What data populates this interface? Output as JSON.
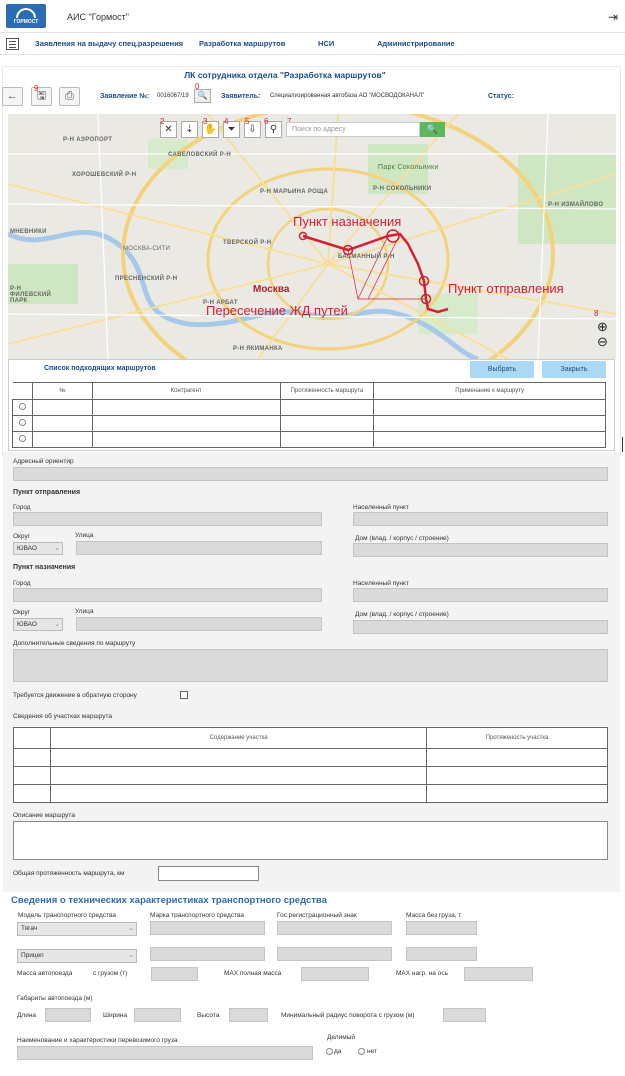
{
  "app": {
    "title": "АИС \"Гормост\"",
    "logo_text": "ГОРМОСТ"
  },
  "nav": {
    "items": [
      "Заявления на выдачу спец.разрешения",
      "Разработка маршрутов",
      "НСИ",
      "Администрирование"
    ]
  },
  "page": {
    "title": "ЛК сотрудника отдела \"Разработка маршрутов\""
  },
  "toolbar": {
    "application_label": "Заявление №:",
    "application_value": "0016067/19",
    "applicant_label": "Заявитель:",
    "applicant_value": "Специализированная автобаза АО \"МОСВОДОКАНАЛ\"",
    "status_label": "Статус:",
    "markers": [
      "0",
      "9"
    ]
  },
  "map": {
    "search_placeholder": "Поиск по адресу",
    "tool_markers": [
      "2",
      "3",
      "4",
      "5",
      "6",
      "7",
      "8"
    ],
    "annotations": {
      "destination": "Пункт назначения",
      "departure": "Пункт отправления",
      "crossing": "Пересечение ЖД путей",
      "city": "Москва"
    },
    "districts": [
      "Р-Н АЭРОПОРТ",
      "САВЕЛОВСКИЙ Р-Н",
      "ХОРОШЕВСКИЙ Р-Н",
      "Р-Н МАРЬИНА РОЩА",
      "МНЕВНИКИ",
      "ТВЕРСКОЙ Р-Н",
      "БАСМАННЫЙ Р-Н",
      "ПРЕСНЕНСКИЙ Р-Н",
      "Р-Н ФИЛЕВСКИЙ ПАРК",
      "Р-Н АРБАТ",
      "Р-Н ЯКИМАНКА",
      "Парк Сокольники",
      "Р-Н СОКОЛЬНИКИ",
      "Р-Н ИЗМАЙЛОВО",
      "МОСКВА-СИТИ"
    ]
  },
  "routes": {
    "title": "Список подходящих маршрутов",
    "select_button": "Выбрать",
    "close_button": "Закрыть",
    "columns": [
      "№",
      "Контрагент",
      "Протяженность маршрута",
      "Применание к маршруту"
    ]
  },
  "form": {
    "address_label": "Адресный ориентир",
    "departure_heading": "Пункт отправления",
    "destination_heading": "Пункт назначения",
    "city_label": "Город",
    "settlement_label": "Населенный пункт",
    "okrug_label": "Округ",
    "street_label": "Улица",
    "house_label": "Дом (влад. / корпус / строение)",
    "okrug_value": "ЮВАО",
    "extra_label": "Дополнительные сведения по маршруту",
    "reverse_label": "Требуется движение в обратную сторону",
    "sections_label": "Сведения об участках маршрута",
    "sections_columns": [
      "Содержание участка",
      "Протяженость участка"
    ],
    "description_label": "Описание маршрута",
    "total_label": "Общая протяженность маршрута, км"
  },
  "tech": {
    "heading": "Сведения о технических характеристиках транспортного средства",
    "model_label": "Модель транспортного средства",
    "brand_label": "Марка транспортного средства",
    "plate_label": "Гос.регистрационный знак",
    "mass_empty_label": "Масса без груза, т",
    "model_value": "Тягач",
    "trailer_value": "Прицеп",
    "train_mass_label": "Масса автопоезда",
    "with_cargo_label": "с грузом (т)",
    "max_full_label": "MAX полная масса",
    "max_axle_label": "MAX нагр. на ось",
    "dims_label": "Габариты автопоезда (м)",
    "length_label": "Длина",
    "width_label": "Ширина",
    "height_label": "Высота",
    "radius_label": "Минимальный радиус поворота с грузом (м)",
    "cargo_label": "Наименование и характеристики перевозимого груза",
    "divisible_label": "Делимый",
    "yes_label": "да",
    "no_label": "нет"
  },
  "colors": {
    "accent": "#1a4c8b",
    "route": "#d62030",
    "search_btn": "#5cb85c",
    "button": "#aad8f5"
  }
}
